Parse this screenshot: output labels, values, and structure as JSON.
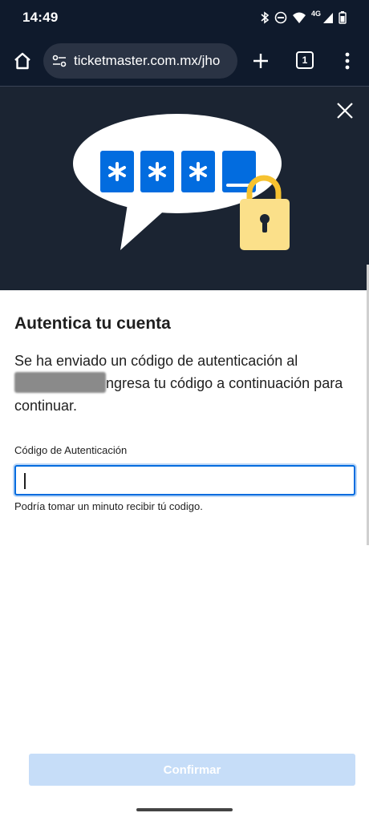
{
  "status_bar": {
    "time": "14:49",
    "network": "4G",
    "icons": [
      "bluetooth-icon",
      "do-not-disturb-icon",
      "wifi-icon",
      "cell-signal-icon",
      "battery-icon"
    ]
  },
  "browser": {
    "url": "ticketmaster.com.mx/jho",
    "tab_count": "1",
    "icons": [
      "home-icon",
      "site-settings-icon",
      "plus-icon",
      "more-vert-icon"
    ]
  },
  "modal": {
    "close_icon": "close-icon",
    "title": "Autentica tu cuenta",
    "description_part1": "Se ha enviado un código de autenticación al",
    "description_part2": "ngresa tu código a continuación para continuar.",
    "field_label": "Código de Autenticación",
    "field_value": "",
    "helper_text": "Podría tomar un minuto recibir tú codigo.",
    "confirm_label": "Confirmar"
  },
  "colors": {
    "accent": "#026cdf",
    "header_bg": "#0f1a2c",
    "hero_bg": "#1b2432",
    "confirm_disabled": "#c6ddf8",
    "lock_yellow": "#f6c230"
  }
}
